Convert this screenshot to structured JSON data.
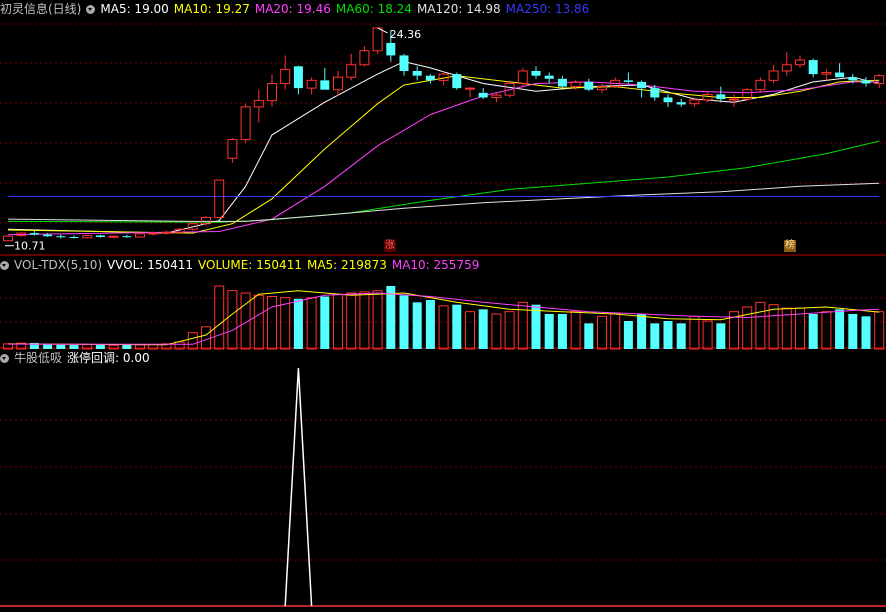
{
  "main_header": {
    "stock_name": "初灵信息(日线)",
    "items": [
      {
        "label": "MA5: 19.00",
        "color": "#ffffff"
      },
      {
        "label": "MA10: 19.27",
        "color": "#ffff00"
      },
      {
        "label": "MA20: 19.46",
        "color": "#ff40ff"
      },
      {
        "label": "MA60: 18.24",
        "color": "#00e000"
      },
      {
        "label": "MA120: 14.98",
        "color": "#e0e0e0"
      },
      {
        "label": "MA250: 13.86",
        "color": "#3838ff"
      }
    ]
  },
  "vol_header": {
    "name": "VOL-TDX(5,10)",
    "items": [
      {
        "label": "VVOL: 150411",
        "color": "#ffffff"
      },
      {
        "label": "VOLUME: 150411",
        "color": "#ffff00"
      },
      {
        "label": "MA5: 219873",
        "color": "#ffff00"
      },
      {
        "label": "MA10: 255759",
        "color": "#ff40ff"
      }
    ]
  },
  "ind_header": {
    "name": "牛股低吸",
    "items": [
      {
        "label": "涨停回调: 0.00",
        "color": "#ffffff"
      }
    ]
  },
  "badges": {
    "zhang": "涨",
    "bang": "榜"
  },
  "colors": {
    "up": "#ff3232",
    "down": "#54ffff",
    "grid": "#7a0000",
    "divider": "#c00000"
  },
  "chart_data": [
    {
      "type": "candlestick",
      "title": "初灵信息(日线)",
      "ylim": [
        10.5,
        25.0
      ],
      "annotations": [
        {
          "text": "24.36",
          "type": "high"
        },
        {
          "text": "10.71",
          "type": "low"
        }
      ],
      "candles": [
        [
          10.71,
          11.05,
          10.71,
          11.0
        ],
        [
          11.05,
          11.25,
          10.95,
          11.2
        ],
        [
          11.2,
          11.35,
          11.05,
          11.1
        ],
        [
          11.1,
          11.2,
          10.95,
          11.0
        ],
        [
          11.0,
          11.1,
          10.85,
          10.95
        ],
        [
          10.95,
          11.05,
          10.85,
          10.9
        ],
        [
          10.9,
          11.1,
          10.85,
          11.05
        ],
        [
          11.05,
          11.1,
          10.9,
          10.95
        ],
        [
          10.95,
          11.05,
          10.85,
          11.0
        ],
        [
          11.0,
          11.1,
          10.9,
          10.95
        ],
        [
          10.95,
          11.2,
          10.9,
          11.15
        ],
        [
          11.15,
          11.3,
          11.05,
          11.2
        ],
        [
          11.2,
          11.35,
          11.1,
          11.25
        ],
        [
          11.25,
          11.5,
          11.2,
          11.45
        ],
        [
          11.45,
          11.85,
          11.35,
          11.8
        ],
        [
          11.8,
          12.3,
          11.7,
          12.2
        ],
        [
          12.2,
          14.6,
          12.2,
          14.6
        ],
        [
          16.0,
          17.3,
          15.7,
          17.2
        ],
        [
          17.2,
          19.5,
          17.0,
          19.3
        ],
        [
          19.3,
          20.4,
          18.3,
          19.7
        ],
        [
          19.7,
          21.4,
          19.3,
          20.8
        ],
        [
          20.8,
          22.6,
          20.4,
          21.7
        ],
        [
          21.9,
          21.95,
          20.1,
          20.5
        ],
        [
          20.5,
          21.2,
          20.1,
          21.0
        ],
        [
          21.0,
          21.8,
          20.4,
          20.4
        ],
        [
          20.4,
          21.6,
          20.0,
          21.2
        ],
        [
          21.2,
          22.7,
          21.0,
          22.0
        ],
        [
          22.0,
          23.2,
          21.9,
          22.9
        ],
        [
          22.9,
          24.36,
          22.7,
          24.36
        ],
        [
          23.4,
          24.2,
          22.2,
          22.6
        ],
        [
          22.6,
          22.7,
          21.3,
          21.6
        ],
        [
          21.6,
          21.9,
          21.0,
          21.3
        ],
        [
          21.3,
          21.4,
          20.8,
          21.0
        ],
        [
          21.0,
          21.6,
          20.7,
          21.4
        ],
        [
          21.4,
          21.5,
          20.4,
          20.5
        ],
        [
          20.5,
          20.6,
          19.9,
          20.5
        ],
        [
          20.2,
          20.5,
          19.8,
          19.9
        ],
        [
          19.9,
          20.2,
          19.6,
          20.05
        ],
        [
          20.05,
          21.0,
          19.9,
          20.8
        ],
        [
          20.8,
          21.8,
          20.6,
          21.6
        ],
        [
          21.6,
          21.9,
          21.1,
          21.3
        ],
        [
          21.3,
          21.5,
          20.8,
          21.1
        ],
        [
          21.1,
          21.3,
          20.5,
          20.6
        ],
        [
          20.6,
          21.0,
          20.4,
          20.9
        ],
        [
          20.9,
          21.1,
          20.3,
          20.4
        ],
        [
          20.4,
          20.8,
          20.2,
          20.6
        ],
        [
          20.6,
          21.2,
          20.5,
          21.0
        ],
        [
          21.0,
          21.5,
          20.8,
          20.9
        ],
        [
          20.9,
          21.0,
          19.9,
          20.5
        ],
        [
          20.5,
          20.7,
          19.7,
          19.9
        ],
        [
          19.9,
          20.1,
          19.3,
          19.6
        ],
        [
          19.6,
          19.8,
          19.3,
          19.45
        ],
        [
          19.5,
          19.9,
          19.3,
          19.75
        ],
        [
          19.75,
          20.3,
          19.6,
          20.1
        ],
        [
          20.1,
          20.6,
          19.6,
          19.8
        ],
        [
          19.8,
          20.1,
          19.3,
          19.8
        ],
        [
          19.8,
          20.5,
          19.7,
          20.4
        ],
        [
          20.4,
          21.2,
          20.2,
          21.0
        ],
        [
          21.0,
          22.0,
          20.8,
          21.6
        ],
        [
          21.6,
          22.8,
          21.3,
          22.0
        ],
        [
          22.0,
          22.6,
          21.8,
          22.3
        ],
        [
          22.3,
          22.4,
          21.2,
          21.4
        ],
        [
          21.4,
          21.7,
          21.0,
          21.5
        ],
        [
          21.5,
          22.1,
          21.2,
          21.2
        ],
        [
          21.2,
          21.4,
          20.8,
          21.0
        ],
        [
          21.0,
          21.2,
          20.6,
          20.8
        ],
        [
          20.8,
          21.4,
          20.5,
          21.3
        ]
      ],
      "ma_lines": [
        {
          "name": "MA5",
          "color": "#ffffff",
          "points": [
            [
              0,
              11.45
            ],
            [
              12,
              11.2
            ],
            [
              16,
              12.0
            ],
            [
              18,
              14.2
            ],
            [
              20,
              17.5
            ],
            [
              24,
              19.6
            ],
            [
              28,
              21.4
            ],
            [
              30,
              22.2
            ],
            [
              32,
              21.8
            ],
            [
              36,
              20.8
            ],
            [
              40,
              20.3
            ],
            [
              44,
              20.6
            ],
            [
              48,
              20.7
            ],
            [
              52,
              19.8
            ],
            [
              55,
              19.6
            ],
            [
              58,
              20.1
            ],
            [
              61,
              20.9
            ],
            [
              64,
              21.2
            ],
            [
              66,
              20.8
            ]
          ]
        },
        {
          "name": "MA10",
          "color": "#ffff00",
          "points": [
            [
              0,
              11.4
            ],
            [
              14,
              11.2
            ],
            [
              17,
              11.8
            ],
            [
              20,
              13.4
            ],
            [
              24,
              16.6
            ],
            [
              28,
              19.5
            ],
            [
              30,
              20.7
            ],
            [
              34,
              21.3
            ],
            [
              38,
              20.9
            ],
            [
              42,
              20.5
            ],
            [
              46,
              20.6
            ],
            [
              50,
              20.2
            ],
            [
              54,
              19.9
            ],
            [
              57,
              19.9
            ],
            [
              60,
              20.3
            ],
            [
              63,
              20.9
            ],
            [
              66,
              21.0
            ]
          ]
        },
        {
          "name": "MA20",
          "color": "#ff40ff",
          "points": [
            [
              0,
              11.1
            ],
            [
              16,
              11.3
            ],
            [
              20,
              12.1
            ],
            [
              24,
              14.2
            ],
            [
              28,
              16.8
            ],
            [
              32,
              18.8
            ],
            [
              36,
              20.0
            ],
            [
              40,
              20.8
            ],
            [
              44,
              20.9
            ],
            [
              48,
              20.7
            ],
            [
              52,
              20.3
            ],
            [
              56,
              20.2
            ],
            [
              60,
              20.4
            ],
            [
              64,
              20.9
            ],
            [
              66,
              20.9
            ]
          ]
        },
        {
          "name": "MA60",
          "color": "#00e000",
          "points": [
            [
              0,
              11.95
            ],
            [
              16,
              11.9
            ],
            [
              20,
              12.05
            ],
            [
              26,
              12.5
            ],
            [
              32,
              13.3
            ],
            [
              38,
              14.0
            ],
            [
              44,
              14.4
            ],
            [
              50,
              14.8
            ],
            [
              56,
              15.4
            ],
            [
              62,
              16.3
            ],
            [
              66,
              17.1
            ]
          ]
        },
        {
          "name": "MA120",
          "color": "#e0e0e0",
          "points": [
            [
              0,
              12.1
            ],
            [
              14,
              11.95
            ],
            [
              18,
              11.95
            ],
            [
              24,
              12.35
            ],
            [
              30,
              12.8
            ],
            [
              36,
              13.15
            ],
            [
              42,
              13.4
            ],
            [
              48,
              13.65
            ],
            [
              54,
              13.85
            ],
            [
              60,
              14.2
            ],
            [
              66,
              14.4
            ]
          ]
        },
        {
          "name": "MA250",
          "color": "#3838ff",
          "points": [
            [
              0,
              13.55
            ],
            [
              66,
              13.55
            ]
          ]
        }
      ]
    },
    {
      "type": "bar",
      "title": "VOL-TDX(5,10)",
      "ylim": [
        0,
        330000
      ],
      "values": [
        22000,
        25000,
        26000,
        20000,
        18000,
        17000,
        19000,
        18000,
        16000,
        17000,
        18000,
        20000,
        22000,
        30000,
        70000,
        95000,
        270000,
        250000,
        240000,
        230000,
        225000,
        220000,
        215000,
        220000,
        225000,
        235000,
        240000,
        245000,
        250000,
        270000,
        230000,
        200000,
        210000,
        185000,
        190000,
        160000,
        170000,
        150000,
        160000,
        200000,
        190000,
        150000,
        150000,
        160000,
        110000,
        140000,
        150000,
        120000,
        150000,
        110000,
        120000,
        110000,
        140000,
        120000,
        110000,
        160000,
        180000,
        200000,
        190000,
        175000,
        175000,
        150000,
        160000,
        170000,
        150000,
        140000,
        160000
      ],
      "ma_lines": [
        {
          "name": "MA5",
          "color": "#ffff00",
          "points": [
            [
              0,
              22000
            ],
            [
              12,
              18000
            ],
            [
              15,
              60000
            ],
            [
              17,
              150000
            ],
            [
              19,
              235000
            ],
            [
              22,
              250000
            ],
            [
              26,
              230000
            ],
            [
              30,
              240000
            ],
            [
              34,
              200000
            ],
            [
              38,
              170000
            ],
            [
              42,
              160000
            ],
            [
              46,
              150000
            ],
            [
              50,
              130000
            ],
            [
              54,
              125000
            ],
            [
              58,
              170000
            ],
            [
              62,
              180000
            ],
            [
              66,
              158000
            ]
          ]
        },
        {
          "name": "MA10",
          "color": "#ff40ff",
          "points": [
            [
              0,
              21000
            ],
            [
              14,
              20000
            ],
            [
              17,
              80000
            ],
            [
              20,
              180000
            ],
            [
              24,
              230000
            ],
            [
              28,
              240000
            ],
            [
              32,
              225000
            ],
            [
              36,
              200000
            ],
            [
              40,
              180000
            ],
            [
              44,
              160000
            ],
            [
              48,
              150000
            ],
            [
              52,
              140000
            ],
            [
              56,
              135000
            ],
            [
              60,
              150000
            ],
            [
              64,
              165000
            ],
            [
              66,
              170000
            ]
          ]
        }
      ]
    },
    {
      "type": "line",
      "title": "牛股低吸",
      "series": [
        {
          "name": "涨停回调",
          "values": [
            0,
            0,
            0,
            0,
            0,
            0,
            0,
            0,
            0,
            0,
            0,
            0,
            0,
            0,
            0,
            0,
            0,
            0,
            0,
            0,
            0,
            0,
            1,
            0,
            0,
            0,
            0,
            0,
            0,
            0,
            0,
            0,
            0,
            0,
            0,
            0,
            0,
            0,
            0,
            0,
            0,
            0,
            0,
            0,
            0,
            0,
            0,
            0,
            0,
            0,
            0,
            0,
            0,
            0,
            0,
            0,
            0,
            0,
            0,
            0,
            0,
            0,
            0,
            0,
            0,
            0,
            0
          ]
        }
      ],
      "ylim": [
        0,
        1
      ]
    }
  ]
}
